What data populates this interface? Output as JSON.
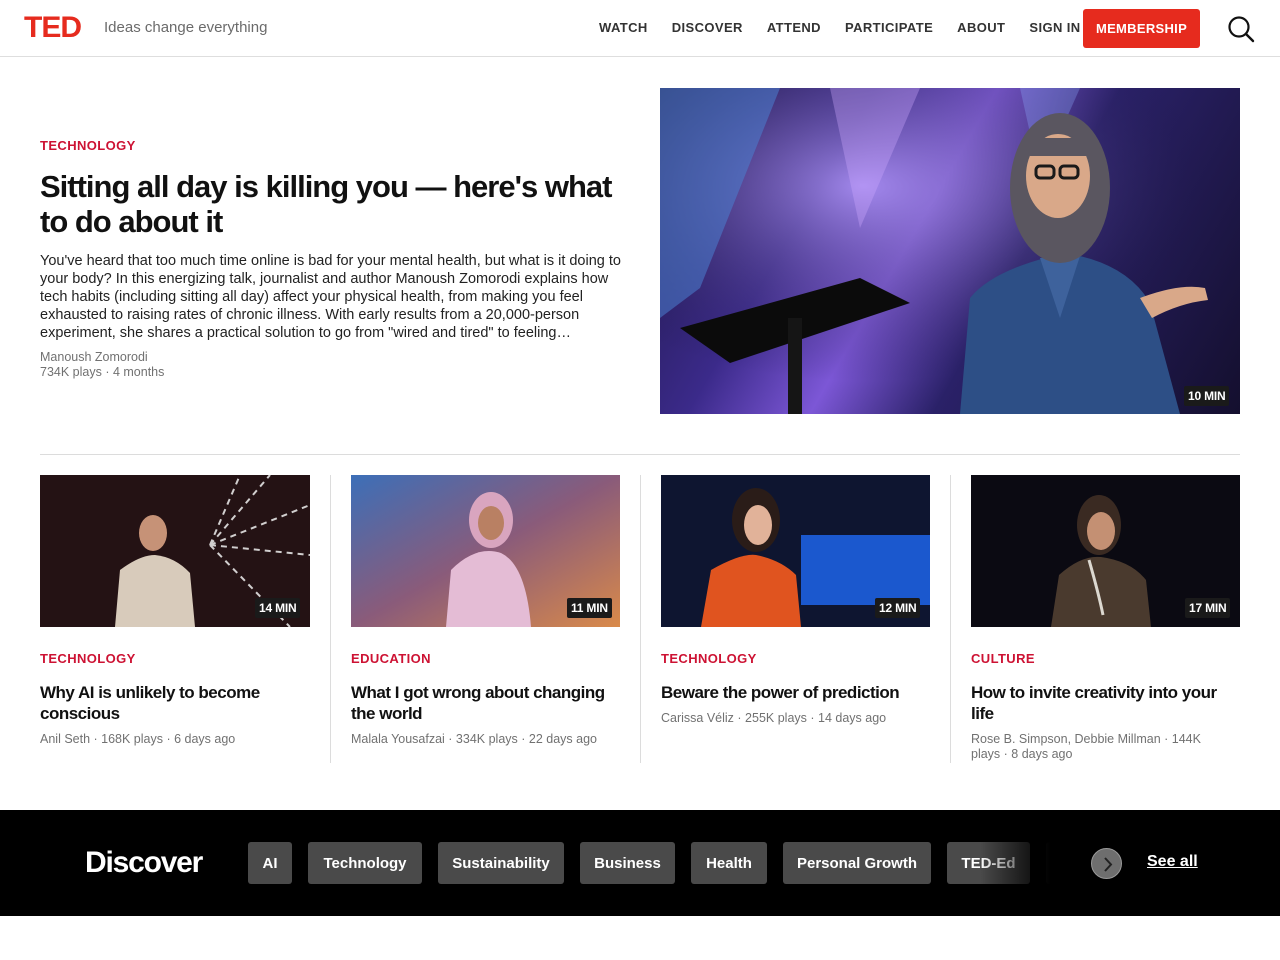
{
  "header": {
    "logo": "TED",
    "tagline": "Ideas change everything",
    "nav": [
      "WATCH",
      "DISCOVER",
      "ATTEND",
      "PARTICIPATE",
      "ABOUT",
      "SIGN IN"
    ],
    "membership": "MEMBERSHIP",
    "brand_color": "#e62b1e"
  },
  "hero": {
    "topic": "TECHNOLOGY",
    "title": "Sitting all day is killing you — here's what to do about it",
    "description": "You've heard that too much time online is bad for your mental health, but what is it doing to your body? In this energizing talk, journalist and author Manoush Zomorodi explains how tech habits (including sitting all day) affect your physical health, from making you feel exhausted to raising rates of chronic illness. With early results from a 20,000-person experiment, she shares a practical solution to go from \"wired and tired\" to feeling…",
    "speaker": "Manoush Zomorodi",
    "stats": "734K plays · 4 months",
    "duration": "10 MIN"
  },
  "cards": [
    {
      "topic": "TECHNOLOGY",
      "title": "Why AI is unlikely to become conscious",
      "meta": "Anil Seth · 168K plays · 6 days ago",
      "duration": "14 MIN"
    },
    {
      "topic": "EDUCATION",
      "title": "What I got wrong about changing the world",
      "meta": "Malala Yousafzai · 334K plays · 22 days ago",
      "duration": "11 MIN"
    },
    {
      "topic": "TECHNOLOGY",
      "title": "Beware the power of prediction",
      "meta": "Carissa Véliz · 255K plays · 14 days ago",
      "duration": "12 MIN"
    },
    {
      "topic": "CULTURE",
      "title": "How to invite creativity into your life",
      "meta": "Rose B. Simpson, Debbie Millman · 144K plays · 8 days ago",
      "duration": "17 MIN"
    }
  ],
  "discover": {
    "title": "Discover",
    "topics": [
      "AI",
      "Technology",
      "Sustainability",
      "Business",
      "Health",
      "Personal Growth",
      "TED-Ed"
    ],
    "see_all": "See all"
  },
  "colors": {
    "topic": "#cd1233",
    "meta": "#717171",
    "pill": "#4a4a4a"
  }
}
